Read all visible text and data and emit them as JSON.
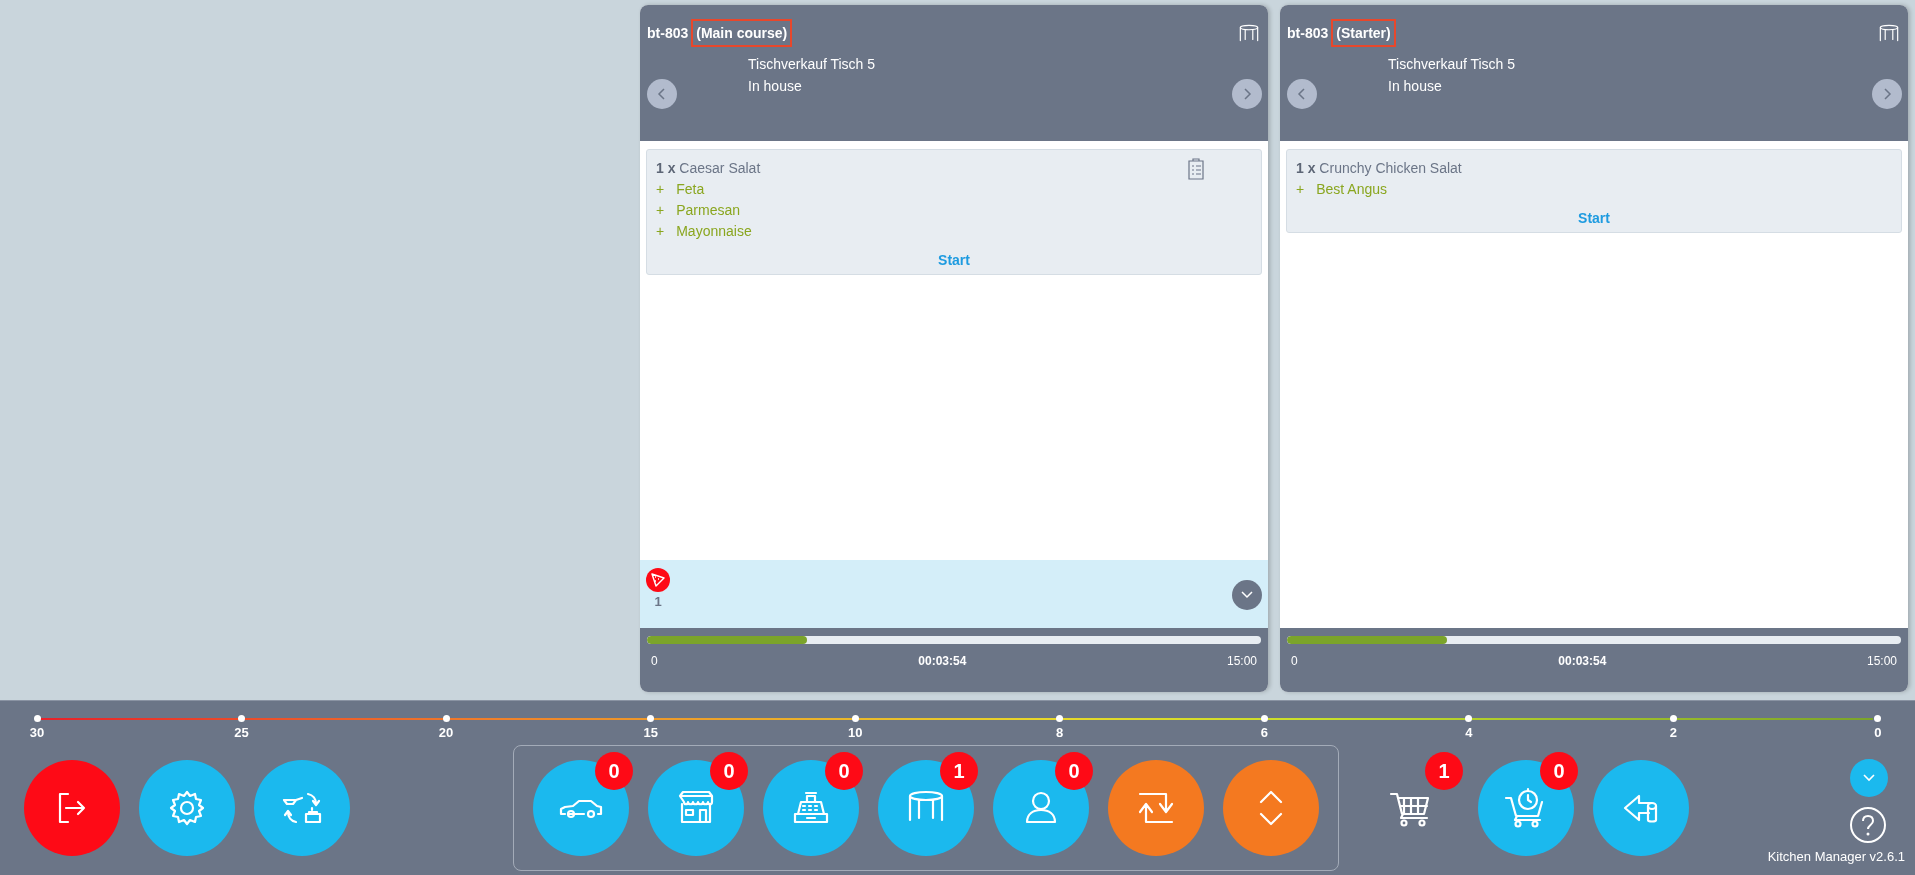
{
  "cards": [
    {
      "code": "bt-803",
      "course": "(Main course)",
      "highlighted": true,
      "table": "Tischverkauf Tisch 5",
      "mode": "In house",
      "items": [
        {
          "quantity": "1 x",
          "name": "Caesar Salat",
          "has_note": true,
          "extras": [
            {
              "sign": "+",
              "name": "Feta"
            },
            {
              "sign": "+",
              "name": "Parmesan"
            },
            {
              "sign": "+",
              "name": "Mayonnaise"
            }
          ],
          "action": "Start"
        }
      ],
      "alert": {
        "kind": "pizza",
        "count": "1"
      },
      "progress": {
        "start": "0",
        "elapsed": "00:03:54",
        "end": "15:00",
        "level": 0.26
      }
    },
    {
      "code": "bt-803",
      "course": "(Starter)",
      "highlighted": true,
      "table": "Tischverkauf Tisch 5",
      "mode": "In house",
      "items": [
        {
          "quantity": "1 x",
          "name": "Crunchy Chicken Salat",
          "has_note": false,
          "extras": [
            {
              "sign": "+",
              "name": "Best Angus"
            }
          ],
          "action": "Start"
        }
      ],
      "progress": {
        "start": "0",
        "elapsed": "00:03:54",
        "end": "15:00",
        "level": 0.26
      }
    }
  ],
  "timeline": {
    "ticks": [
      "30",
      "25",
      "20",
      "15",
      "10",
      "8",
      "6",
      "4",
      "2",
      "0"
    ]
  },
  "toolbar": {
    "left_buttons": [
      {
        "kind": "exit",
        "color": "#fe0a16"
      },
      {
        "kind": "settings",
        "color": "#1bb9ee"
      },
      {
        "kind": "swap",
        "color": "#1bb9ee"
      }
    ],
    "group_buttons": [
      {
        "kind": "car",
        "color": "#1bb9ee",
        "badge": "0"
      },
      {
        "kind": "store",
        "color": "#1bb9ee",
        "badge": "0"
      },
      {
        "kind": "register",
        "color": "#1bb9ee",
        "badge": "0"
      },
      {
        "kind": "table",
        "color": "#1bb9ee",
        "badge": "1"
      },
      {
        "kind": "person",
        "color": "#1bb9ee",
        "badge": "0"
      },
      {
        "kind": "refresh",
        "color": "#f47920"
      },
      {
        "kind": "updown",
        "color": "#f47920"
      }
    ],
    "right_buttons": [
      {
        "kind": "cart",
        "badge": "1"
      },
      {
        "kind": "cart-clock",
        "color": "#1bb9ee",
        "badge": "0"
      },
      {
        "kind": "back",
        "color": "#1bb9ee"
      }
    ],
    "version": "Kitchen Manager v2.6.1"
  }
}
